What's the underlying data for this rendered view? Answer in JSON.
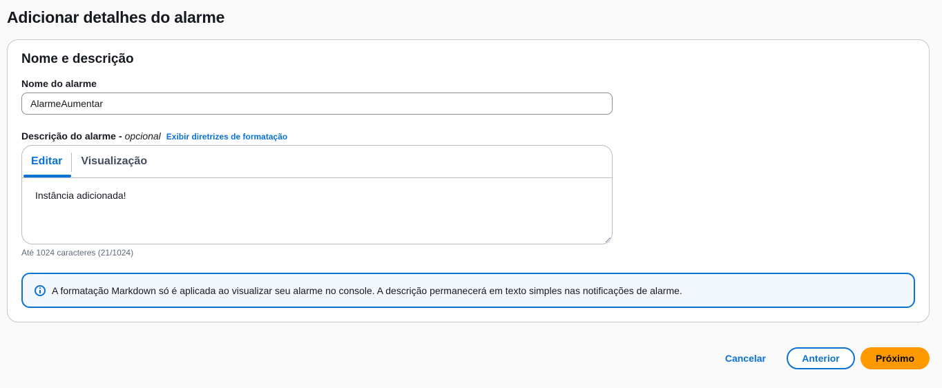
{
  "page": {
    "title": "Adicionar detalhes do alarme"
  },
  "section": {
    "title": "Nome e descrição"
  },
  "alarm_name": {
    "label": "Nome do alarme",
    "value": "AlarmeAumentar"
  },
  "description": {
    "label": "Descrição do alarme",
    "dash": "-",
    "optional": "opcional",
    "format_link": "Exibir diretrizes de formatação",
    "tabs": [
      {
        "label": "Editar",
        "active": true
      },
      {
        "label": "Visualização",
        "active": false
      }
    ],
    "value": "Instância adicionada!",
    "char_count": "Até 1024 caracteres (21/1024)"
  },
  "alert": {
    "icon": "info-icon",
    "text": "A formatação Markdown só é aplicada ao visualizar seu alarme no console. A descrição permanecerá em texto simples nas notificações de alarme."
  },
  "actions": {
    "cancel": "Cancelar",
    "previous": "Anterior",
    "next": "Próximo"
  },
  "colors": {
    "accent": "#0972d3",
    "primary_button": "#ff9900",
    "alert_background": "#f2f8fd"
  }
}
